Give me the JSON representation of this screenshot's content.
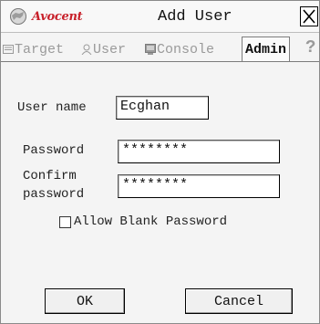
{
  "window": {
    "brand": "Avocent",
    "title": "Add User"
  },
  "tabs": [
    {
      "label": "Target",
      "icon": "target-icon",
      "active": false
    },
    {
      "label": "User",
      "icon": "user-icon",
      "active": false
    },
    {
      "label": "Console",
      "icon": "console-icon",
      "active": false
    },
    {
      "label": "Admin",
      "icon": "",
      "active": true
    }
  ],
  "help": "?",
  "form": {
    "username_label": "User name",
    "username_value": "Ecghan",
    "password_label": "Password",
    "password_value": "********",
    "confirm_label_1": "Confirm",
    "confirm_label_2": "password",
    "confirm_value": "********",
    "allow_blank_label": "Allow Blank Password",
    "allow_blank_checked": false
  },
  "buttons": {
    "ok": "OK",
    "cancel": "Cancel"
  },
  "colors": {
    "brand_red": "#c8202a",
    "tab_inactive": "#9a9a9a"
  }
}
